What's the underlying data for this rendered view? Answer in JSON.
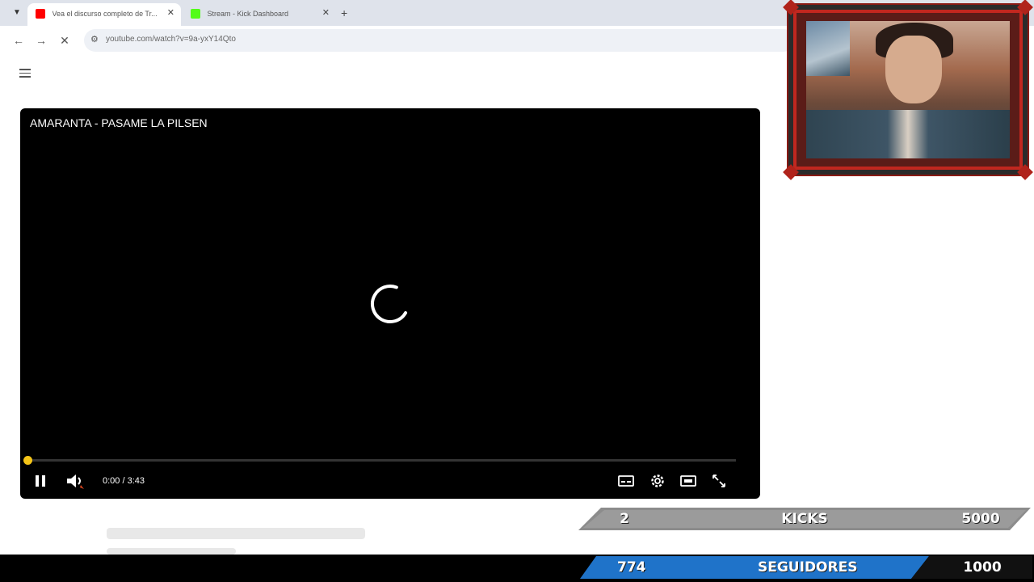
{
  "browser": {
    "tabs": [
      {
        "title": "Vea el discurso completo de Tr...",
        "favicon_color": "#ff0000",
        "active": true
      },
      {
        "title": "Stream - Kick Dashboard",
        "favicon_color": "#53fc18",
        "active": false
      }
    ],
    "new_tab_label": "+",
    "url": "youtube.com/watch?v=9a-yxY14Qto"
  },
  "player": {
    "title": "AMARANTA - PASAME LA PILSEN",
    "timecode": "0:00 / 3:43",
    "progress": 0.0,
    "accent_color": "#f5c518",
    "controls": [
      "pause-icon",
      "volume-icon",
      "subtitles-icon",
      "settings-icon",
      "theater-icon",
      "fullscreen-icon"
    ]
  },
  "overlay": {
    "kicks": {
      "current": "2",
      "label": "KICKS",
      "target": "5000",
      "color": "#8c8c8c"
    },
    "followers": {
      "current": "774",
      "label": "SEGUIDORES",
      "target": "1000",
      "color": "#1f73c9"
    }
  }
}
